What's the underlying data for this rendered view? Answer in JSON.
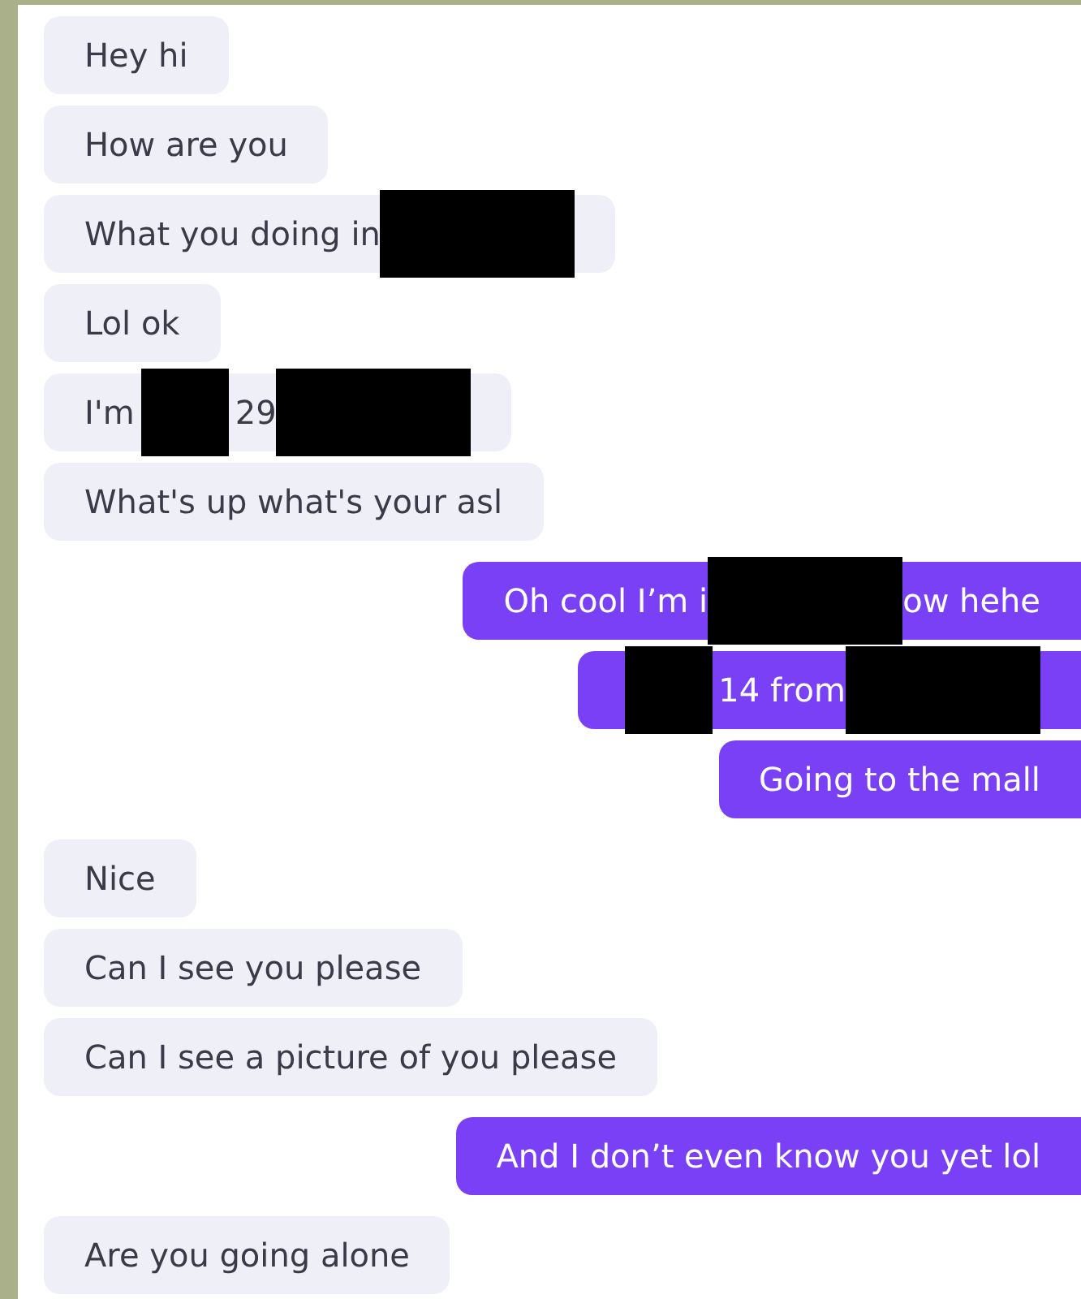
{
  "messages": [
    {
      "kind": "received",
      "parts": [
        {
          "kind": "text",
          "text": "Hey hi"
        }
      ]
    },
    {
      "kind": "received",
      "parts": [
        {
          "kind": "text",
          "text": "How are you"
        }
      ]
    },
    {
      "kind": "received",
      "parts": [
        {
          "kind": "text",
          "text": "What you doing in"
        },
        {
          "kind": "long-redaction"
        }
      ]
    },
    {
      "kind": "received",
      "parts": [
        {
          "kind": "text",
          "text": "Lol ok"
        }
      ]
    },
    {
      "kind": "received",
      "parts": [
        {
          "kind": "text",
          "text": "I'm"
        },
        {
          "kind": "short-redaction"
        },
        {
          "kind": "text",
          "text": "29"
        },
        {
          "kind": "long-redaction"
        }
      ]
    },
    {
      "kind": "received",
      "parts": [
        {
          "kind": "text",
          "text": "What's up what's your asl"
        }
      ]
    },
    {
      "kind": "sent",
      "parts": [
        {
          "kind": "text",
          "text": "Oh cool I’m i"
        },
        {
          "kind": "long-redaction"
        },
        {
          "kind": "text",
          "text": "ow hehe"
        }
      ]
    },
    {
      "kind": "sent",
      "parts": [
        {
          "kind": "short-redaction"
        },
        {
          "kind": "text",
          "text": "14 from"
        },
        {
          "kind": "long-redaction"
        }
      ]
    },
    {
      "kind": "sent",
      "parts": [
        {
          "kind": "text",
          "text": "Going to the mall"
        }
      ]
    },
    {
      "kind": "received",
      "parts": [
        {
          "kind": "text",
          "text": "Nice"
        }
      ]
    },
    {
      "kind": "received",
      "parts": [
        {
          "kind": "text",
          "text": "Can I see you please"
        }
      ]
    },
    {
      "kind": "received",
      "parts": [
        {
          "kind": "text",
          "text": "Can I see a picture of you please"
        }
      ]
    },
    {
      "kind": "sent",
      "parts": [
        {
          "kind": "text",
          "text": "And I don’t even know you yet lol"
        }
      ]
    },
    {
      "kind": "received",
      "parts": [
        {
          "kind": "text",
          "text": "Are you going alone"
        }
      ]
    }
  ]
}
